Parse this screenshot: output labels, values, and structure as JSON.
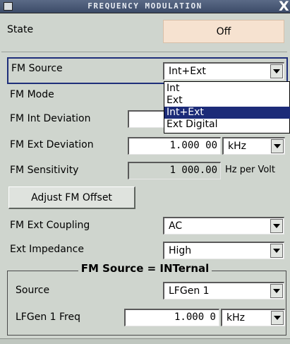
{
  "window": {
    "title": "FREQUENCY MODULATION",
    "close_glyph": "X"
  },
  "state": {
    "label": "State",
    "value": "Off"
  },
  "fm_source": {
    "label": "FM Source",
    "selected": "Int+Ext",
    "options": [
      "Int",
      "Ext",
      "Int+Ext",
      "Ext Digital"
    ]
  },
  "fm_mode": {
    "label": "FM Mode"
  },
  "fm_int_deviation": {
    "label": "FM Int Deviation"
  },
  "fm_ext_deviation": {
    "label": "FM Ext Deviation",
    "value": "1.000 00",
    "unit": "kHz"
  },
  "fm_sensitivity": {
    "label": "FM Sensitivity",
    "value": "1 000.00",
    "unit": "Hz per Volt"
  },
  "adjust_button": {
    "label": "Adjust FM Offset"
  },
  "fm_ext_coupling": {
    "label": "FM Ext Coupling",
    "value": "AC"
  },
  "ext_impedance": {
    "label": "Ext Impedance",
    "value": "High"
  },
  "group": {
    "title": "FM Source = INTernal",
    "source": {
      "label": "Source",
      "value": "LFGen 1"
    },
    "lfgen_freq": {
      "label": "LFGen 1 Freq",
      "value": "1.000 0",
      "unit": "kHz"
    }
  },
  "colors": {
    "accent": "#1c2b78",
    "state_button": "#f6e2d0",
    "panel": "#cfd5ce"
  }
}
